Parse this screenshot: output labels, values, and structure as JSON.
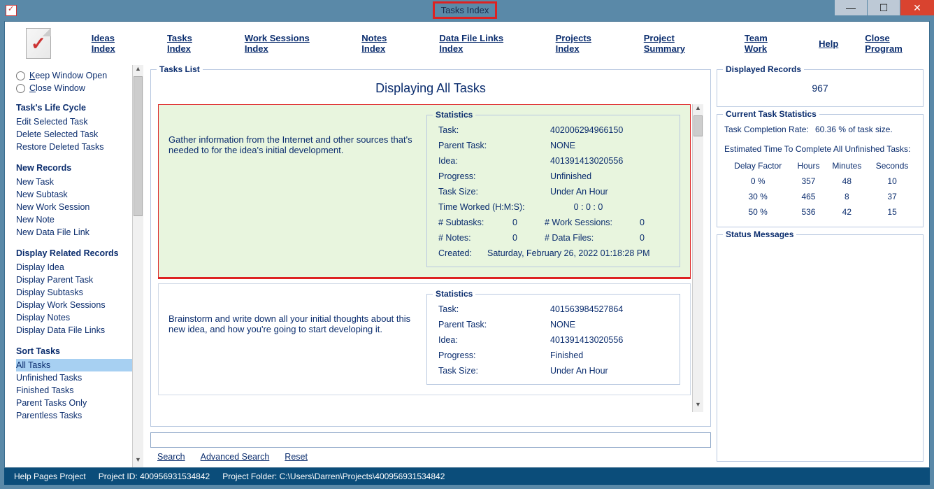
{
  "window": {
    "title": "Tasks Index"
  },
  "nav": {
    "items": [
      "Ideas Index",
      "Tasks Index",
      "Work Sessions Index",
      "Notes Index",
      "Data File Links Index",
      "Projects Index",
      "Project Summary",
      "Team Work",
      "Help",
      "Close Program"
    ]
  },
  "sidebar": {
    "radios": {
      "keep": "Keep Window Open",
      "close": "Close Window"
    },
    "groups": [
      {
        "heading": "Task's Life Cycle",
        "links": [
          "Edit Selected Task",
          "Delete Selected Task",
          "Restore Deleted Tasks"
        ]
      },
      {
        "heading": "New Records",
        "links": [
          "New Task",
          "New Subtask",
          "New Work Session",
          "New Note",
          "New Data File Link"
        ]
      },
      {
        "heading": "Display Related Records",
        "links": [
          "Display Idea",
          "Display Parent Task",
          "Display Subtasks",
          "Display Work Sessions",
          "Display Notes",
          "Display Data File Links"
        ]
      },
      {
        "heading": "Sort Tasks",
        "links": [
          "All Tasks",
          "Unfinished Tasks",
          "Finished Tasks",
          "Parent Tasks Only",
          "Parentless Tasks"
        ],
        "selected": 0
      }
    ]
  },
  "tasksList": {
    "legend": "Tasks List",
    "title": "Displaying All Tasks",
    "tasks": [
      {
        "highlight": true,
        "desc": "Gather information from the Internet and other sources that's needed to for the idea's initial development.",
        "stats": {
          "legend": "Statistics",
          "task": "402006294966150",
          "parent": "NONE",
          "idea": "401391413020556",
          "progress": "Unfinished",
          "size": "Under An Hour",
          "timeWorkedLabel": "Time Worked (H:M:S):",
          "timeWorked": "0  :  0  :  0",
          "subtasksLabel": "# Subtasks:",
          "subtasks": "0",
          "workSessionsLabel": "# Work Sessions:",
          "workSessions": "0",
          "notesLabel": "# Notes:",
          "notes": "0",
          "dataFilesLabel": "# Data Files:",
          "dataFiles": "0",
          "createdLabel": "Created:",
          "created": "Saturday, February 26, 2022   01:18:28 PM"
        }
      },
      {
        "highlight": false,
        "desc": "Brainstorm and write down all your initial thoughts about this new idea, and how you're going to start developing it.",
        "stats": {
          "legend": "Statistics",
          "task": "401563984527864",
          "parent": "NONE",
          "idea": "401391413020556",
          "progress": "Finished",
          "size": "Under An Hour"
        }
      }
    ]
  },
  "statLabels": {
    "task": "Task:",
    "parent": "Parent Task:",
    "idea": "Idea:",
    "progress": "Progress:",
    "size": "Task Size:"
  },
  "search": {
    "placeholder": "",
    "search": "Search",
    "advanced": "Advanced Search",
    "reset": "Reset"
  },
  "displayed": {
    "legend": "Displayed Records",
    "count": "967"
  },
  "currentStats": {
    "legend": "Current Task Statistics",
    "rateLabel": "Task Completion Rate:",
    "rateValue": "60.36 % of task size.",
    "estLabel": "Estimated Time To Complete All Unfinished Tasks:",
    "cols": [
      "Delay Factor",
      "Hours",
      "Minutes",
      "Seconds"
    ],
    "rows": [
      [
        "0 %",
        "357",
        "48",
        "10"
      ],
      [
        "30 %",
        "465",
        "8",
        "37"
      ],
      [
        "50 %",
        "536",
        "42",
        "15"
      ]
    ]
  },
  "statusMsgs": {
    "legend": "Status Messages"
  },
  "statusbar": {
    "project": "Help Pages Project",
    "projectId": "Project ID: 400956931534842",
    "folder": "Project Folder: C:\\Users\\Darren\\Projects\\400956931534842"
  }
}
